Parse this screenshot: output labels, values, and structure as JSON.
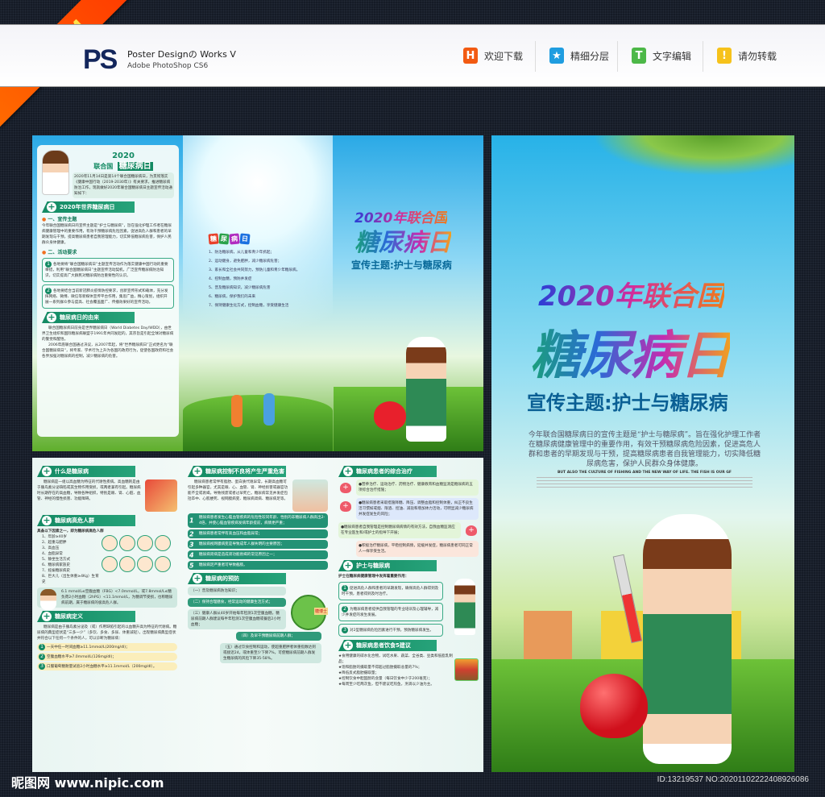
{
  "ribbon": "三折页DM",
  "header": {
    "logo": "PS",
    "brand_line1": "Poster Designの Works V",
    "brand_line2": "Adobe PhotoShop CS6",
    "features": [
      {
        "icon": "h-icon",
        "label": "欢迎下载",
        "color": "#f25a12",
        "glyph": "H"
      },
      {
        "icon": "star-icon",
        "label": "精细分层",
        "color": "#1f9de0",
        "glyph": "★"
      },
      {
        "icon": "text-icon",
        "label": "文字编辑",
        "color": "#4db848",
        "glyph": "T"
      },
      {
        "icon": "warning-icon",
        "label": "请勿转载",
        "color": "#f6c21b",
        "glyph": "!"
      }
    ]
  },
  "outside": {
    "left": {
      "title_year": "2020",
      "title_prefix": "联合国",
      "title_main": "糖尿病日",
      "intro": "2020年11月14日是第14个联合国糖尿病日，为贯彻落实《健康中国行动（2019-2030年）》有关要求，推进糖尿病防治工作，现就做好2020年联合国糖尿病日主题宣传活动通知如下：",
      "sec1": "2020年世界糖尿病日",
      "sub1": "一、宣传主题",
      "sub1_text": "今年联合国糖尿病日的宣传主题是“护士与糖尿病”，旨在强化护理工作者在糖尿病健康管理中的重要作用，有效干预糖尿病危险因素，促进高危人群和患者的早期发现与干预，提高糖尿病患者自我管理能力，切实降低糖尿病危害，保护人民群众身体健康。",
      "sub2": "二、活动要求",
      "req": [
        "各地要将“联合国糖尿病日”主题宣传活动作为落实健康中国行动的重要举措，利用“联合国糖尿病日”主题宣传活动契机，广泛宣传糖尿病防治知识，切实提高广大群民对糖尿病防治重要性的认识。",
        "各地要结合当前新冠肺炎疫情防控要求，创新宣传形式和载体，充分发挥网络、微博、微信等新媒体宣传平台作用，集思广益，精心策划，组织开展一系列群众参与度高、社会覆盖面广、传播效果好的宣传活动。"
      ],
      "sec2": "糖尿病日的由来",
      "origin": [
        "联合国糖尿病日前身是世界糖尿病日（World Diabetes Day/WDD），由世界卫生组织和国际糖尿病联盟于1991年共同发起的，其宗旨是引起全球对糖尿病的警觉和醒悟。",
        "2006年底联合国通过决议，从2007年起，将“世界糖尿病日”正式更名为“联合国糖尿病日”，将专家、学术行为上升为各国的政府行为，促使各国政府和社会各界加强对糖尿病的控制，减少糖尿病的危害。"
      ]
    },
    "middle": {
      "badge": [
        "糖",
        "尿",
        "病",
        "日"
      ],
      "items": [
        "1、防治糖尿病，从儿童和青少年抓起；",
        "2、运动健身，避免肥胖，减少糖尿病危害；",
        "3、家长和全社会共同努力，预防儿童和青少年糖尿病。",
        "4、控制血糖，预防并发症",
        "5、普及糖尿病知识，减少糖尿病危害",
        "6、糖尿病，保护我们的未来",
        "7、保持健康生化方式，控制血糖，享受健康生活"
      ]
    },
    "right": {
      "line1": "2020年联合国",
      "line2": "糖尿病日",
      "line3": "宣传主题:护士与糖尿病"
    }
  },
  "cover": {
    "line1": "2020年联合国",
    "line2": "糖尿病日",
    "line3": "宣传主题:护士与糖尿病",
    "body": "今年联合国糖尿病日的宣传主题是“护士与糖尿病”。旨在强化护理工作者在糖尿病健康管理中的重要作用，有效干预糖尿病危险因素，促进高危人群和患者的早期发现与干预，提高糖尿病患者自我管理能力，切实降低糖尿病危害，保护人民群众身体健康。",
    "english_heading": "BUT ALSO THE CULTURE OF FISHING AND THE NEW WAY OF LIFE. THE FISH IS OUR GF"
  },
  "inside": {
    "p1": {
      "sec1": "什么是糖尿病",
      "what": "糖尿病是一组以高血糖为特征的代谢性疾病。高血糖则是由于胰岛素分泌缺陷或其生物作用受损，或两者兼有引起。糖尿病时长期存在的高血糖，导致各种组织，特别是眼、肾、心脏、血管、神经的慢性损害、功能障碍。",
      "sec2": "糖尿病高危人群",
      "risk_intro": "具备以下因素之一，即为糖尿病高危人群",
      "risks": [
        "1、年龄≥40岁",
        "2、超重与肥胖",
        "3、高血压",
        "4、血脂异常",
        "5、静坐生活方式",
        "6、糖尿病家族史",
        "7、妊娠糖尿病史",
        "8、巨大儿（出生体重≥4Kg）生育史"
      ],
      "note": "6.1 mmol/L≤空腹血糖（FBG）<7.0mmol/L，或7.8mmol/L≤糖负荷2小时血糖（2hPG）<11.1mmol/L，为糖调节受损，也称糖尿病前期，属于糖尿病的极高危人群。",
      "sec3": "糖尿病定义",
      "definition": "糖尿病是由于胰岛素分泌及（或）作用缺陷引起的以血糖升高为特征的代谢病。糖尿病的典型症状是“三多一少”（多饮、多食、多尿、体重减轻），出现糖尿病典型症状并符合以下任何一个条件的人，可以诊断为糖尿病：",
      "criteria": [
        "一天中任一时间血糖≥11.1mmol/L(200mg/dl)；",
        "空腹血糖水平≥7.0mmol/L(126mg/dl)；",
        "口服葡萄糖耐量试验2小时血糖水平≥11.1mmol/L（200mg/dl）。"
      ]
    },
    "p2": {
      "sec1": "糖尿病控制不良将产生严重危害",
      "harm": "糖尿病患者常伴有脂肪、蛋白质代谢异常，长期高血糖可引起多种器官，尤其是眼、心、血管、肾、神经损害或器官功能不全或衰竭，导致残废或者过早死亡。糖尿病常见并发症包括卒中、心肌梗死、视网膜病变、糖尿病肾病、糖尿病足等。",
      "points": [
        "糖尿病患者发生心脑血管疾病的危险性较同年龄、性别的非糖尿病人群高出2-4倍，并使心脑血管疾病发病年龄提前，病情更严重；",
        "糖尿病患者常伴有高血压和血脂异常；",
        "糖尿病视网膜病变是导致成年人群失明的主要原因；",
        "糖尿病肾病是造成肾功能衰竭的常见原因之一；",
        "糖尿病足严重者可导致截肢。"
      ],
      "sec2": "糖尿病的预防",
      "sign": "糖博士",
      "prevent": [
        "（一）普及糖尿病防治知识；",
        "（二）保持合理膳食，经常运动的健康生活方式；",
        "（三）健康人群从40岁开始每年检测1次空腹血糖，糖尿病前期人群建议每半年检测1次空腹血糖或餐后2小时血糖；",
        "（四）及早干预糖尿病前期人群；",
        "（五）通过饮食控制和运动，使超重肥胖者体重指数达到或接近24，或体重至少下降7%，可使糖尿病前期人群发生糖尿病的风险下降35-58%。"
      ]
    },
    "p3": {
      "sec1": "糖尿病患者的综合治疗",
      "treat": [
        "●营养治疗、运动治疗、药物治疗、健康教育和血糖监测是糖尿病的五项综合治疗措施；",
        "●糖尿病患者采取措施降糖、降压、调整血脂和控制体重，纠正不良生活习惯如戒烟、限酒、控油、减盐和增加体力活动，可明显减少糖尿病并发症发生的风险；",
        "●糖尿病患者自我管理是控制糖尿病病情的有效方法，自我血糖监测应在专业医生和/或护士的指导下开展；",
        "●积极治疗糖尿病，平稳控制病情，延缓并发症，糖尿病患者可同正常人一样享受生活。"
      ],
      "sec2": "护士与糖尿病",
      "nurse_intro": "护士在糖尿病健康管理中发挥着重要作用：",
      "nurse": [
        "促进高危人群和患者的早期发现，确保高危人群得到及时干预，患者得到及时治疗。",
        "为糖尿病患者提供自我管理的专业培训及心理辅导，减少并发症的发生发展。",
        "对2型糖尿病危险因素进行干预，预防糖尿病发生。"
      ],
      "sec3": "糖尿病患者饮食5建议",
      "diet": [
        "★食用健康的碳水化合物，试吃水果、蔬菜、全谷类、豆类和低脂乳制品；",
        "★饱和脂肪的摄取量不得超过脂肪摄取总量的7%；",
        "★降低反式脂肪摄取量；",
        "★控制饮食中胆固醇的含量（每日饮食中少于200毫克）；",
        "★每周至少吃两次鱼，但不建议吃煎鱼，烹调以少油为主。"
      ]
    }
  },
  "footer": {
    "site": "昵图网 www.nipic.com",
    "id": "ID:13219537 NO:20201102222408926086"
  }
}
